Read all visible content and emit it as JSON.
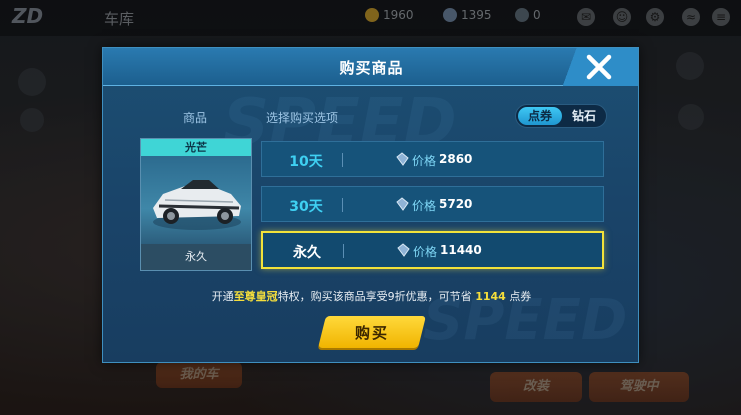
{
  "background": {
    "title": "车库",
    "resource1": "1960",
    "resource2": "1395",
    "resource3": "0",
    "left_button": "我的车",
    "right_button1": "改装",
    "right_button2": "驾驶中"
  },
  "dialog": {
    "title": "购买商品",
    "product_column": "商品",
    "options_column": "选择购买选项",
    "currency": {
      "options": [
        "点券",
        "钻石"
      ],
      "selected": "点券"
    },
    "product": {
      "name": "光芒",
      "duration": "永久"
    },
    "purchase_options": [
      {
        "duration": "10天",
        "price_label": "价格",
        "price": "2860",
        "selected": false
      },
      {
        "duration": "30天",
        "price_label": "价格",
        "price": "5720",
        "selected": false
      },
      {
        "duration": "永久",
        "price_label": "价格",
        "price": "11440",
        "selected": true
      }
    ],
    "promo": {
      "prefix": "开通",
      "highlight": "至尊皇冠",
      "middle": "特权，购买该商品享受9折优惠，可节省",
      "amount": "1144",
      "suffix": "点券"
    },
    "buy_label": "购买"
  },
  "colors": {
    "accent": "#3fd0f2",
    "highlight": "#f5de3c",
    "dialog_bg": "#1a4469"
  }
}
